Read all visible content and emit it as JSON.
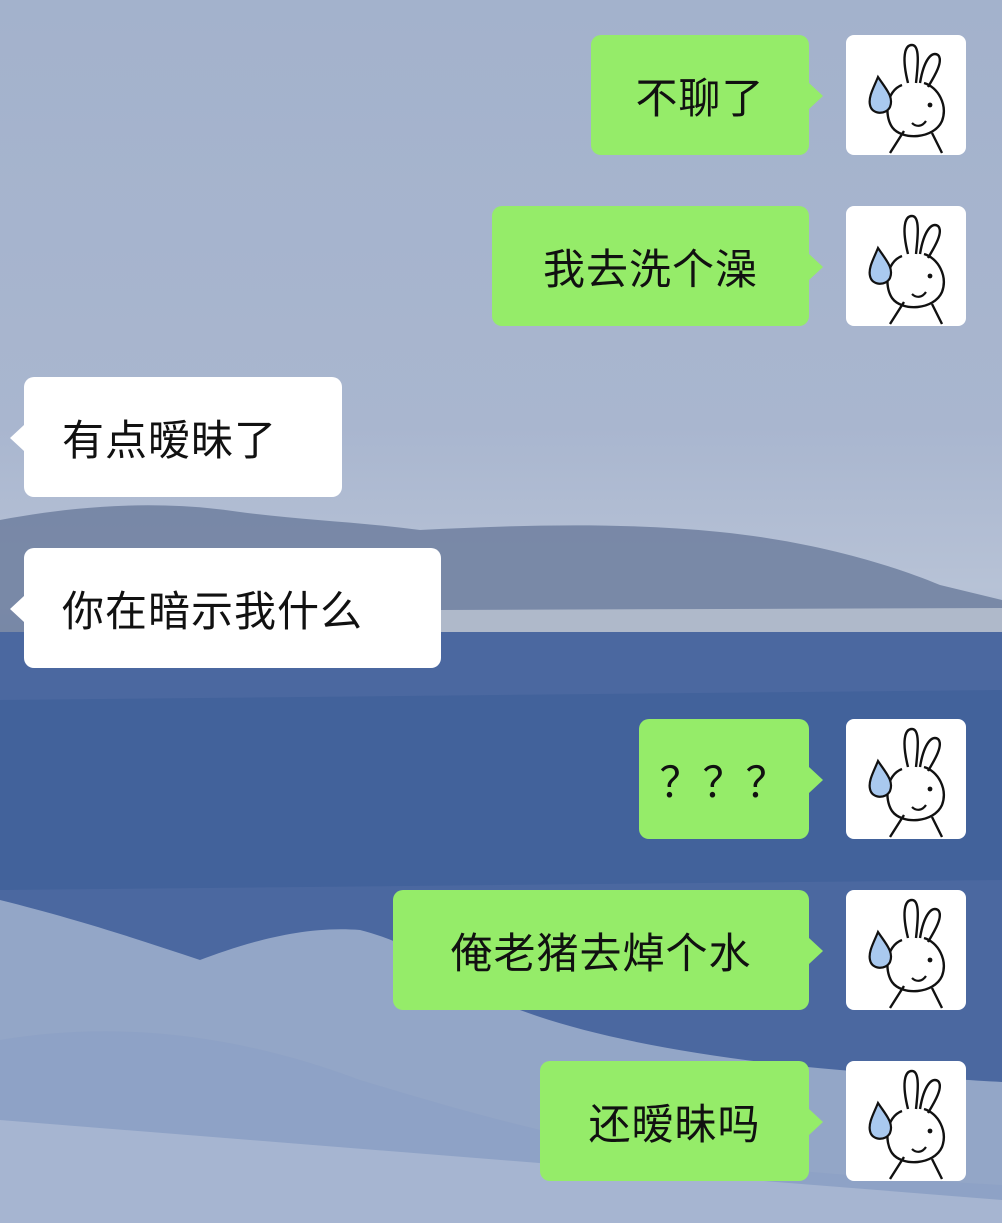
{
  "conversation": {
    "messages": [
      {
        "id": "m1",
        "sender": "me",
        "text": "不聊了"
      },
      {
        "id": "m2",
        "sender": "me",
        "text": "我去洗个澡"
      },
      {
        "id": "m3",
        "sender": "them",
        "text": "有点暧昧了"
      },
      {
        "id": "m4",
        "sender": "them",
        "text": "你在暗示我什么"
      },
      {
        "id": "m5",
        "sender": "me",
        "text": "？？？"
      },
      {
        "id": "m6",
        "sender": "me",
        "text": "俺老猪去焯个水"
      },
      {
        "id": "m7",
        "sender": "me",
        "text": "还暧昧吗"
      }
    ]
  },
  "avatar": {
    "icon": "bunny-sweat-drop-icon"
  },
  "colors": {
    "my_bubble": "#95ec69",
    "their_bubble": "#ffffff",
    "text": "#111111",
    "sweat_drop": "#a9c9ef"
  }
}
